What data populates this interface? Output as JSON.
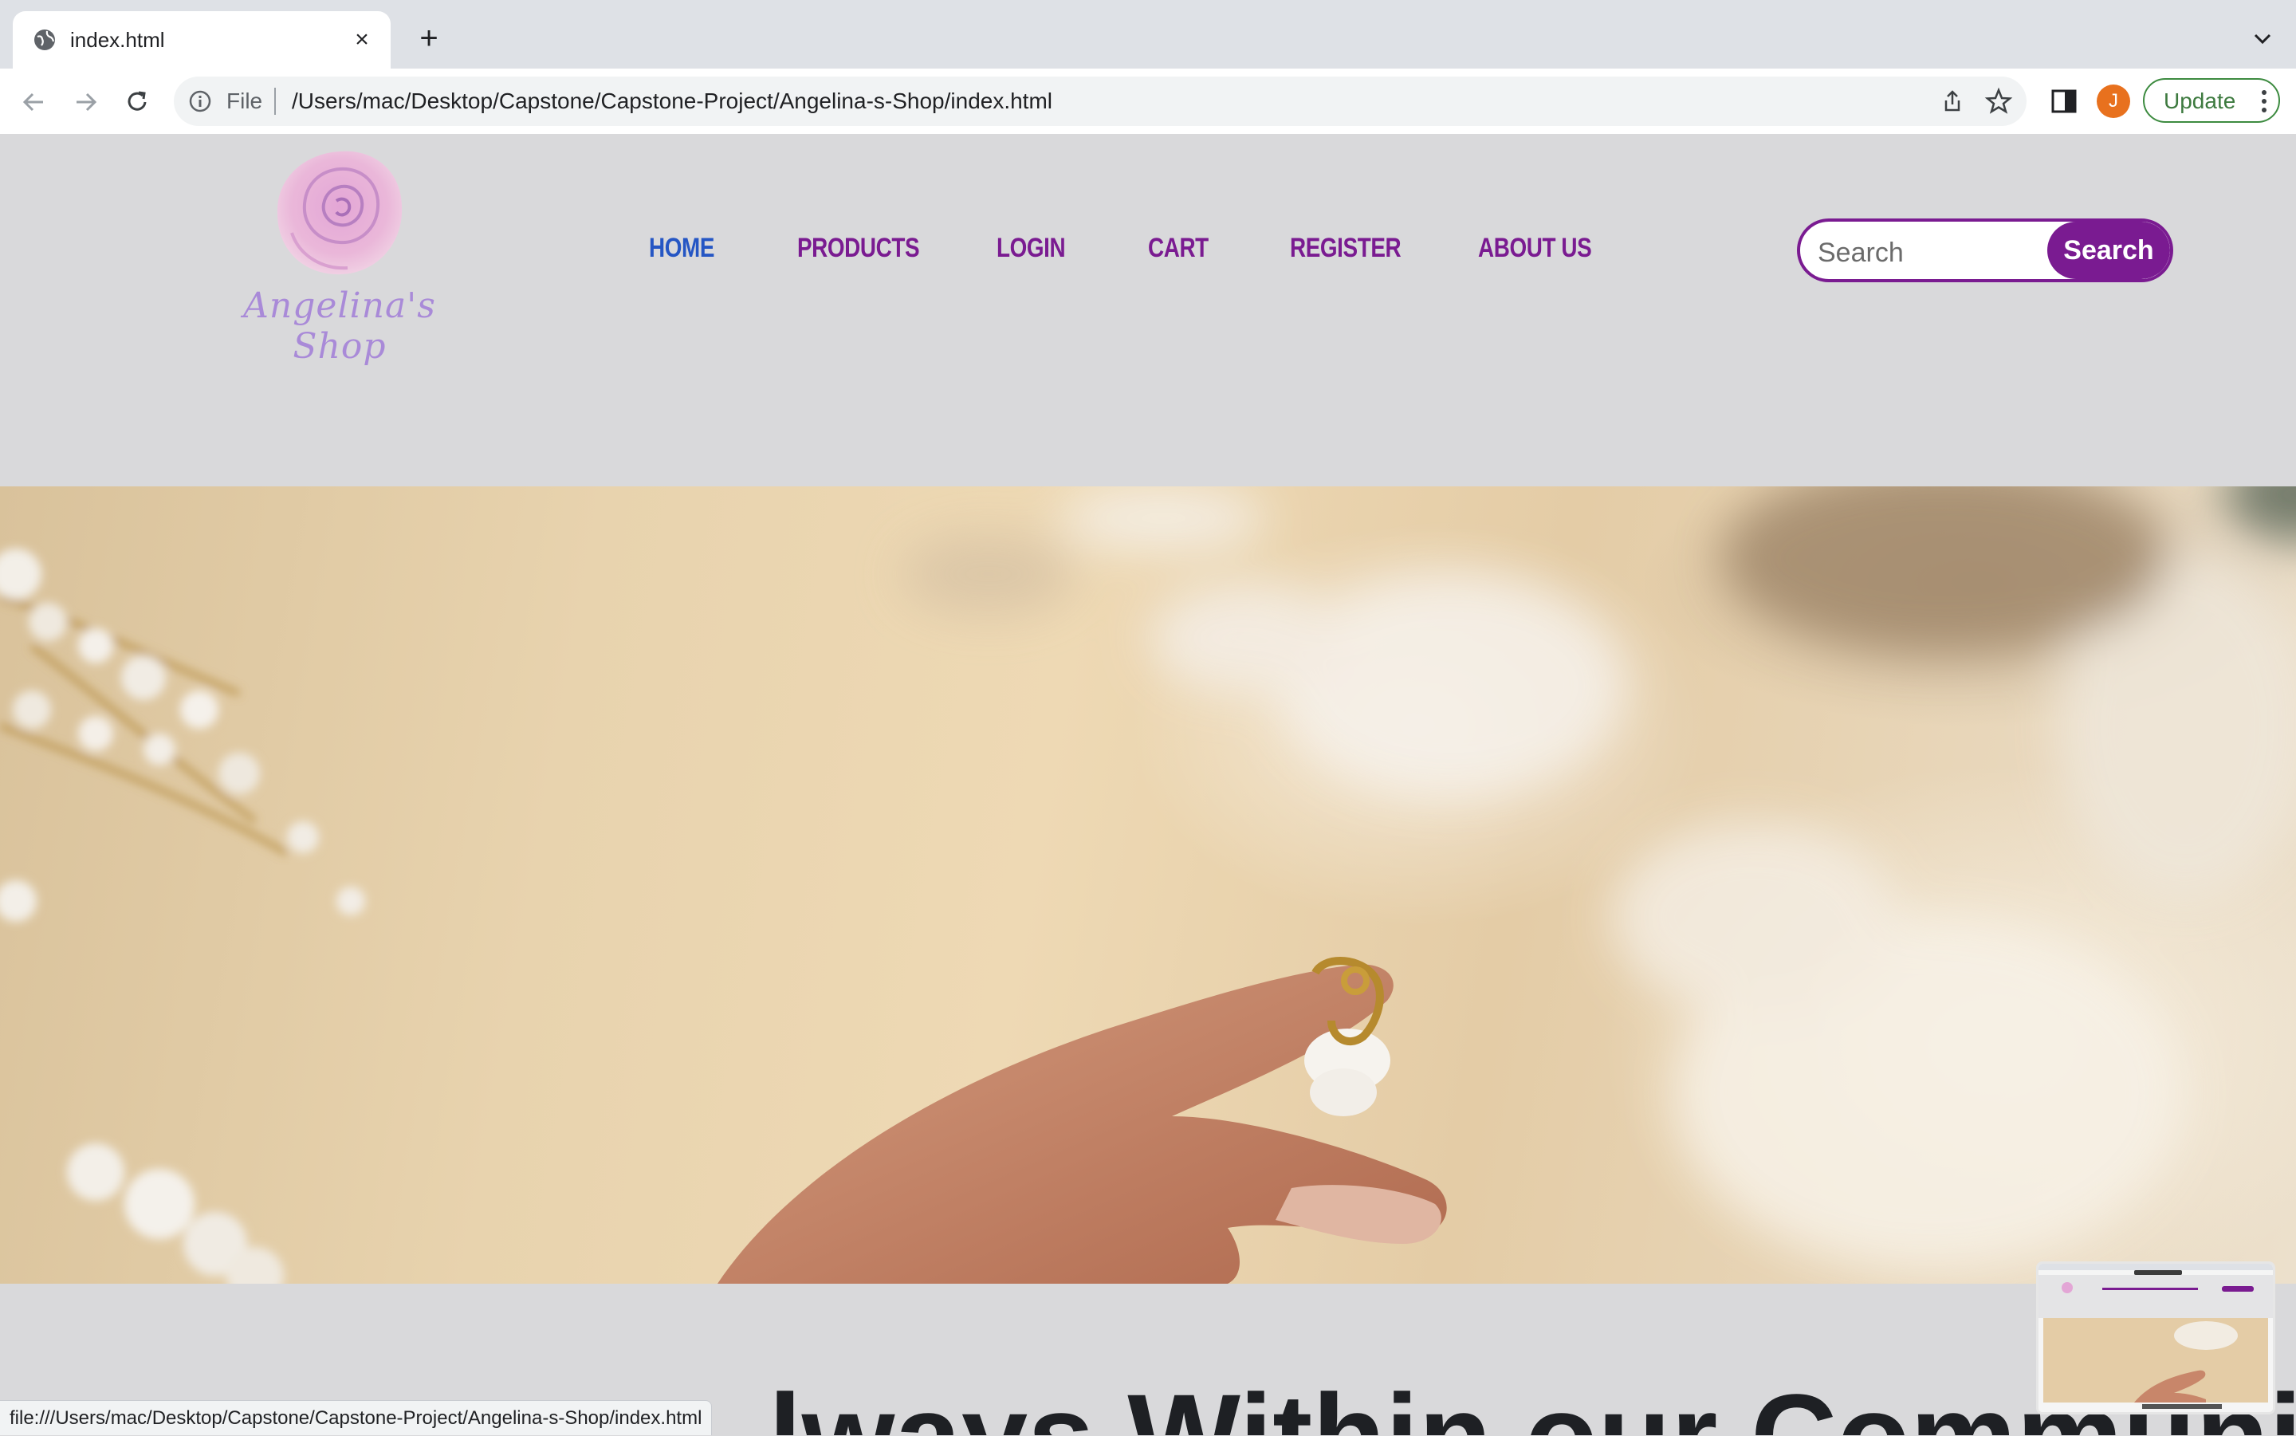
{
  "browser": {
    "tab_title": "index.html",
    "new_tab": "+",
    "close": "×",
    "url_scheme": "File",
    "url": "/Users/mac/Desktop/Capstone/Capstone-Project/Angelina-s-Shop/index.html",
    "avatar_initial": "J",
    "update_label": "Update",
    "status_url": "file:///Users/mac/Desktop/Capstone/Capstone-Project/Angelina-s-Shop/index.html"
  },
  "site": {
    "logo_text": "Angelina's Shop",
    "nav": [
      {
        "label": "HOME",
        "active": true
      },
      {
        "label": "PRODUCTS"
      },
      {
        "label": "LOGIN"
      },
      {
        "label": "CART"
      },
      {
        "label": "REGISTER"
      },
      {
        "label": "ABOUT US"
      }
    ],
    "search": {
      "placeholder": "Search",
      "button": "Search"
    },
    "headline": "lways Within our Community"
  },
  "colors": {
    "brand_purple": "#7a1b91",
    "active_link": "#2556c4",
    "header_bg": "#d9d9db"
  }
}
